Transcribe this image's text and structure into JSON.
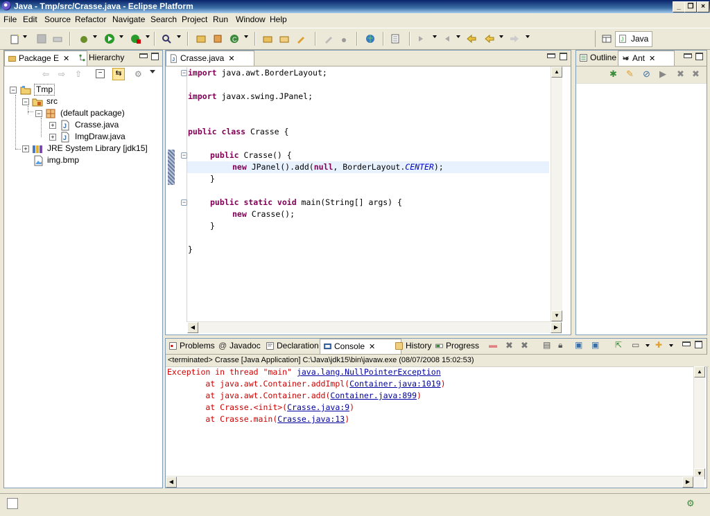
{
  "window": {
    "title": "Java - Tmp/src/Crasse.java - Eclipse Platform"
  },
  "menu": [
    "File",
    "Edit",
    "Source",
    "Refactor",
    "Navigate",
    "Search",
    "Project",
    "Run",
    "Window",
    "Help"
  ],
  "perspective": {
    "label": "Java"
  },
  "left_panel": {
    "tabs": [
      "Package E",
      "Hierarchy"
    ],
    "tree": [
      {
        "label": "Tmp",
        "level": 0,
        "icon": "project-folder-icon"
      },
      {
        "label": "src",
        "level": 1,
        "icon": "source-folder-icon"
      },
      {
        "label": "(default package)",
        "level": 2,
        "icon": "package-icon"
      },
      {
        "label": "Crasse.java",
        "level": 3,
        "icon": "java-file-icon"
      },
      {
        "label": "ImgDraw.java",
        "level": 3,
        "icon": "java-file-icon"
      },
      {
        "label": "JRE System Library [jdk15]",
        "level": 1,
        "icon": "library-icon"
      },
      {
        "label": "img.bmp",
        "level": 1,
        "icon": "image-file-icon"
      }
    ]
  },
  "editor": {
    "tab": "Crasse.java",
    "lines": [
      {
        "kw": "import",
        "rest": " java.awt.BorderLayout;"
      },
      {
        "kw": "import",
        "rest": " javax.swing.JPanel;"
      },
      {
        "kw": "public class",
        "rest": " Crasse {"
      },
      {
        "kw": "public",
        "rest": " Crasse() {"
      },
      {
        "kw": "new",
        "rest": " JPanel().add(",
        "kw2": "null",
        "rest2": ", BorderLayout.",
        "const": "CENTER",
        "rest3": ");"
      },
      {
        "rest": "}"
      },
      {
        "kw": "public static void",
        "rest": " main(String[] args) {"
      },
      {
        "kw": "new",
        "rest": " Crasse();"
      },
      {
        "rest": "}"
      },
      {
        "rest": "}"
      }
    ]
  },
  "right_panel": {
    "tabs": [
      "Outline",
      "Ant"
    ]
  },
  "bottom_panel": {
    "tabs": [
      "Problems",
      "Javadoc",
      "Declaration",
      "Console",
      "History",
      "Progress"
    ],
    "status": "<terminated> Crasse [Java Application] C:\\Java\\jdk15\\bin\\javaw.exe (08/07/2008 15:02:53)",
    "console": [
      {
        "text": "Exception in thread \"main\" ",
        "link": "java.lang.NullPointerException",
        "tail": ""
      },
      {
        "text": "        at java.awt.Container.addImpl(",
        "link": "Container.java:1019",
        "tail": ")"
      },
      {
        "text": "        at java.awt.Container.add(",
        "link": "Container.java:899",
        "tail": ")"
      },
      {
        "text": "        at Crasse.<init>(",
        "link": "Crasse.java:9",
        "tail": ")"
      },
      {
        "text": "        at Crasse.main(",
        "link": "Crasse.java:13",
        "tail": ")"
      }
    ]
  },
  "colors": {
    "keyword": "#7f0055",
    "constant": "#0000c0",
    "error": "#cc0000",
    "link": "#0000a0",
    "titlebar": "#0a246a"
  }
}
